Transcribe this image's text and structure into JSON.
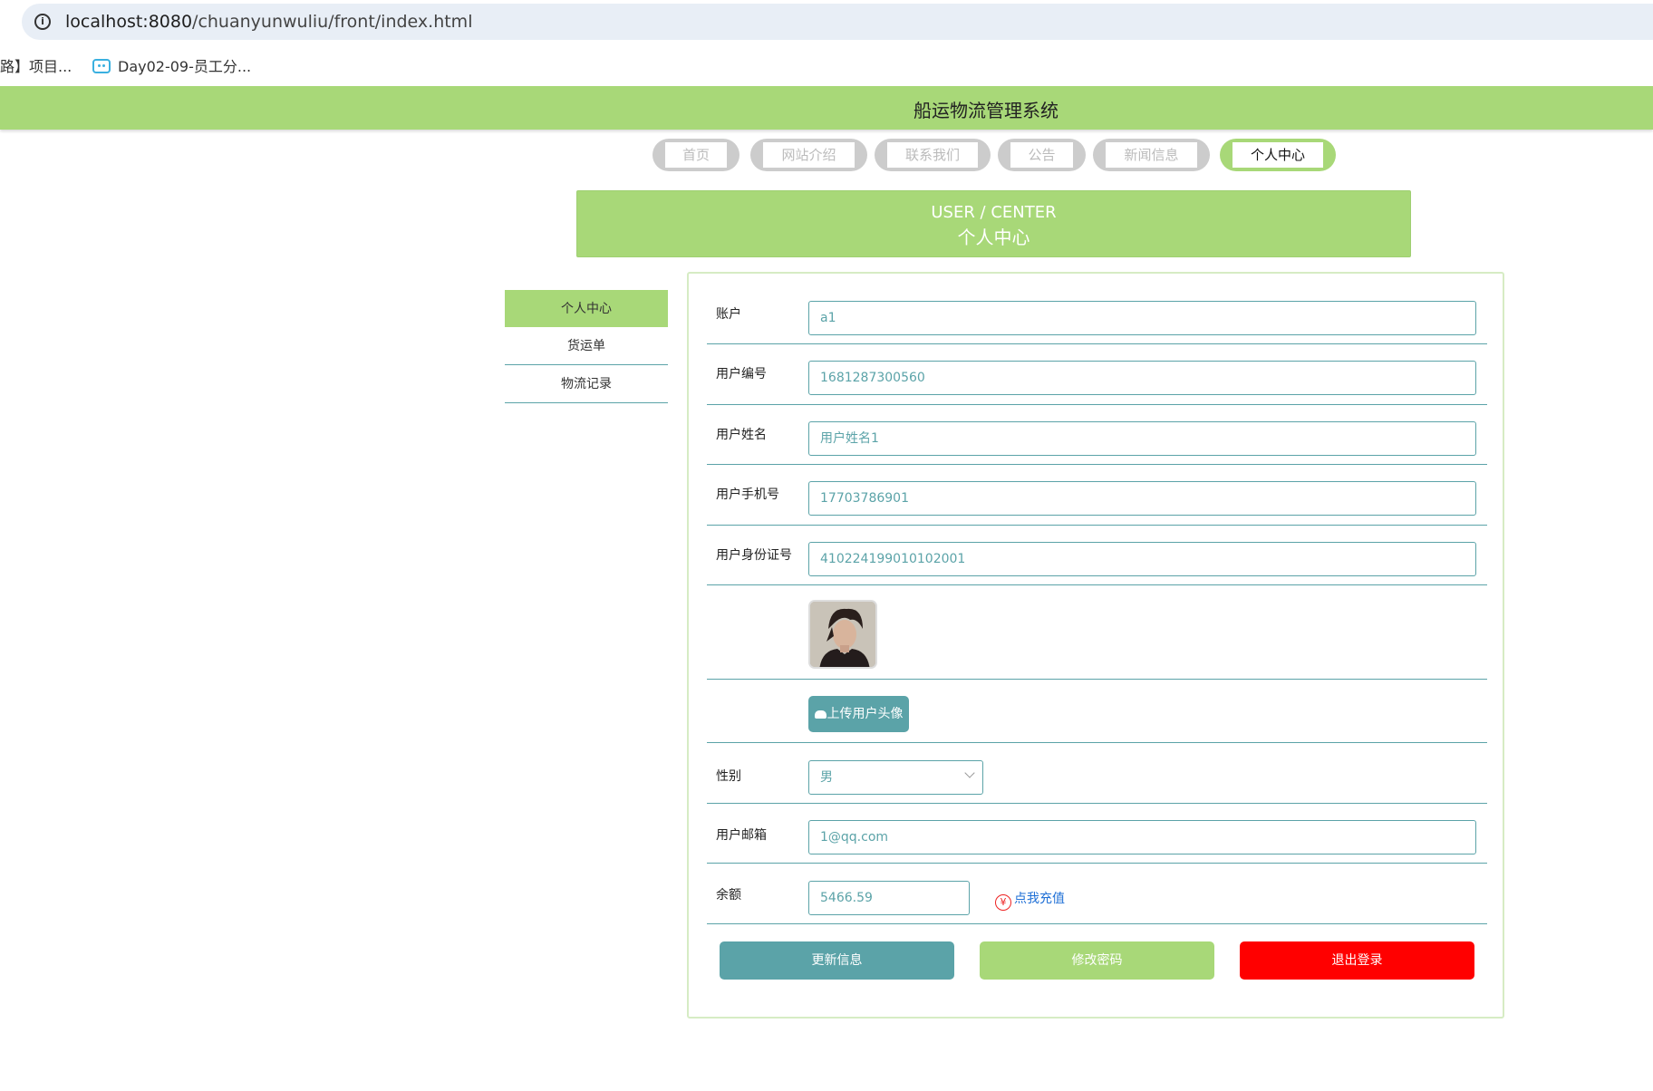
{
  "browser": {
    "url_host": "localhost:8080",
    "url_path": "/chuanyunwuliu/front/index.html",
    "bookmarks": [
      {
        "label": "路】项目..."
      },
      {
        "label": "Day02-09-员工分..."
      }
    ]
  },
  "site": {
    "title": "船运物流管理系统"
  },
  "nav": {
    "items": [
      {
        "label": "首页"
      },
      {
        "label": "网站介绍"
      },
      {
        "label": "联系我们"
      },
      {
        "label": "公告"
      },
      {
        "label": "新闻信息"
      },
      {
        "label": "个人中心"
      }
    ],
    "active": "个人中心"
  },
  "banner": {
    "en": "USER / CENTER",
    "cn": "个人中心"
  },
  "sidebar": {
    "items": [
      {
        "label": "个人中心"
      },
      {
        "label": "货运单"
      },
      {
        "label": "物流记录"
      }
    ],
    "active": "个人中心"
  },
  "form": {
    "account": {
      "label": "账户",
      "value": "a1"
    },
    "user_no": {
      "label": "用户编号",
      "value": "1681287300560"
    },
    "user_name": {
      "label": "用户姓名",
      "value": "用户姓名1"
    },
    "phone": {
      "label": "用户手机号",
      "value": "17703786901"
    },
    "id_card": {
      "label": "用户身份证号",
      "value": "410224199010102001"
    },
    "upload_label": "上传用户头像",
    "gender": {
      "label": "性别",
      "value": "男"
    },
    "email": {
      "label": "用户邮箱",
      "value": "1@qq.com"
    },
    "balance": {
      "label": "余额",
      "value": "5466.59"
    },
    "recharge_label": "点我充值",
    "recharge_icon": "yen-icon"
  },
  "actions": {
    "update": "更新信息",
    "change_password": "修改密码",
    "logout": "退出登录"
  },
  "colors": {
    "primary_green": "#a8d878",
    "teal": "#5ba3a8",
    "red": "#ff0000",
    "link_blue": "#1e6fd6"
  }
}
